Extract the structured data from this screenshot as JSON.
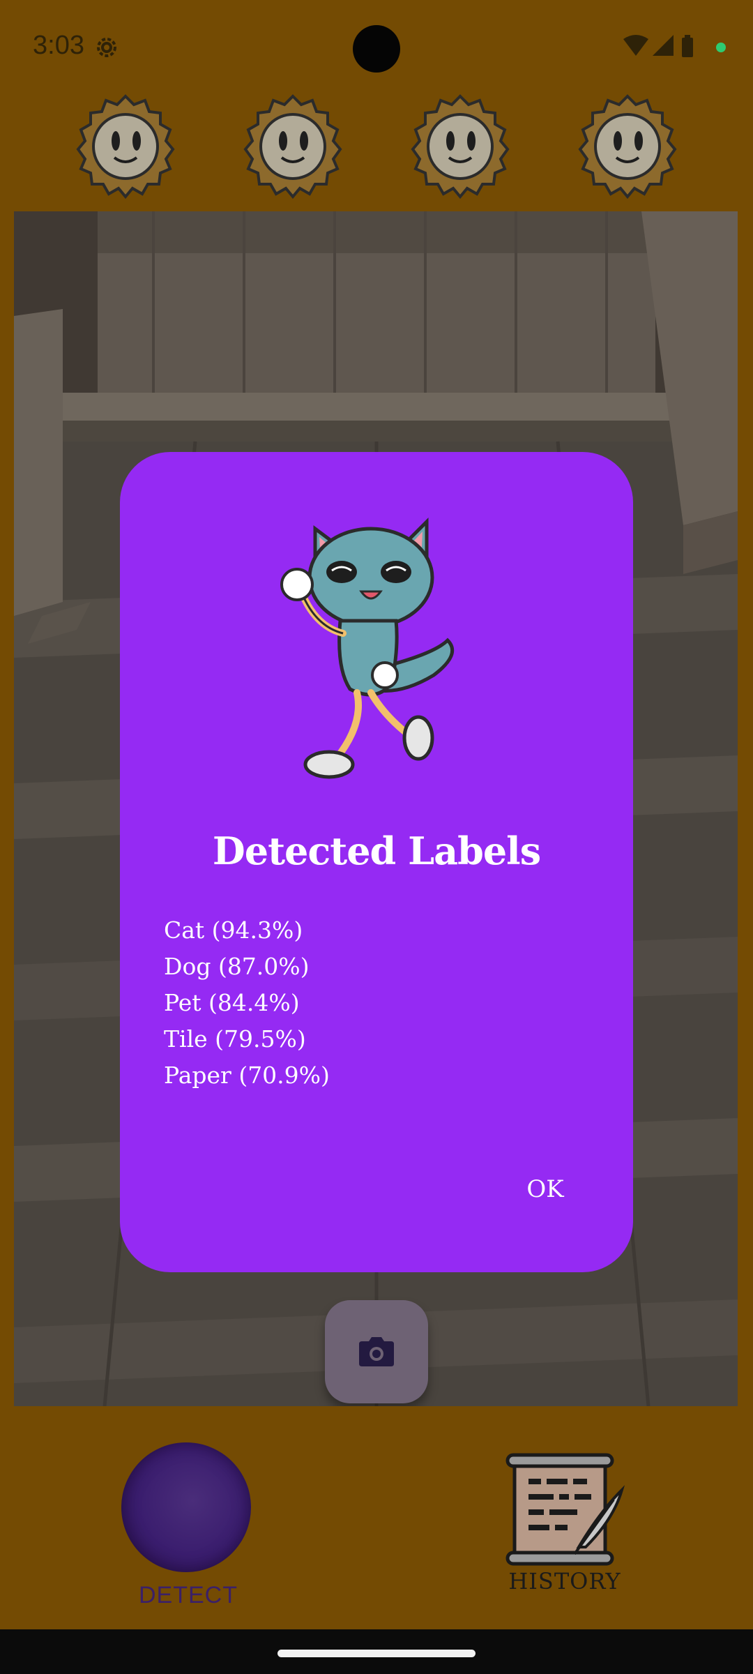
{
  "status_bar": {
    "time": "3:03",
    "icons": [
      "gear-icon",
      "wifi-icon",
      "cellular-signal-icon",
      "battery-icon",
      "privacy-dot-icon"
    ]
  },
  "top_row": {
    "characters": [
      "sun-face-icon",
      "sun-face-icon",
      "sun-face-icon",
      "sun-face-icon"
    ]
  },
  "dialog": {
    "illustration": "dancing-cat-icon",
    "title": "Detected Labels",
    "labels": [
      "Cat (94.3%)",
      "Dog (87.0%)",
      "Pet (84.4%)",
      "Tile (79.5%)",
      "Paper (70.9%)"
    ],
    "ok_label": "OK"
  },
  "capture": {
    "icon": "camera-icon"
  },
  "bottom_nav": {
    "detect_label": "DETECT",
    "history_label": "HISTORY",
    "history_icon": "scroll-quill-icon"
  },
  "colors": {
    "background": "#744b03",
    "dialog": "#952af3",
    "detect": "#3b2067",
    "capture_button": "#6e6274"
  }
}
